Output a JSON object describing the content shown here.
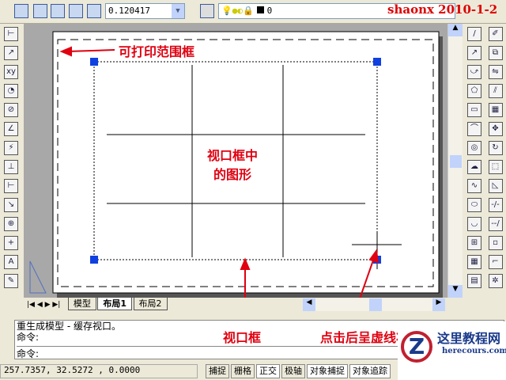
{
  "toolbar": {
    "scale_value": "0.120417",
    "layer_value": "0",
    "watermark": "shaonx 2010-1-2"
  },
  "tabs": [
    "模型",
    "布局1",
    "布局2"
  ],
  "annotations": {
    "print_border": "可打印范围框",
    "viewport_content": [
      "视口框中",
      "的图形"
    ],
    "viewport": "视口框",
    "dashed": "点击后呈虚线状"
  },
  "command": {
    "line1": "重生成模型 - 缓存视口。",
    "line2": "命令:",
    "line3": "命令:"
  },
  "status": {
    "coords": "257.7357, 32.5272 , 0.0000",
    "buttons": [
      "捕捉",
      "栅格",
      "正交",
      "极轴",
      "对象捕捉",
      "对象追踪"
    ]
  },
  "logo": {
    "name": "这里教程网",
    "url": "herecours.com"
  },
  "colors": {
    "annotation": "#e00010",
    "grip": "#1040e0"
  }
}
